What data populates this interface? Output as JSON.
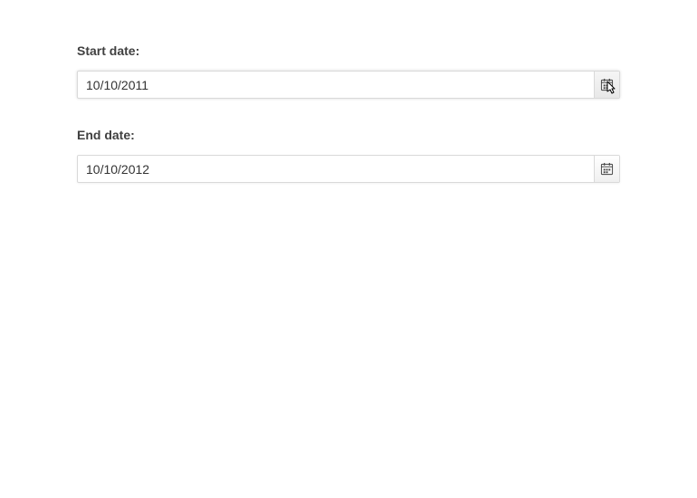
{
  "start": {
    "label": "Start date:",
    "value": "10/10/2011"
  },
  "end": {
    "label": "End date:",
    "value": "10/10/2012"
  }
}
